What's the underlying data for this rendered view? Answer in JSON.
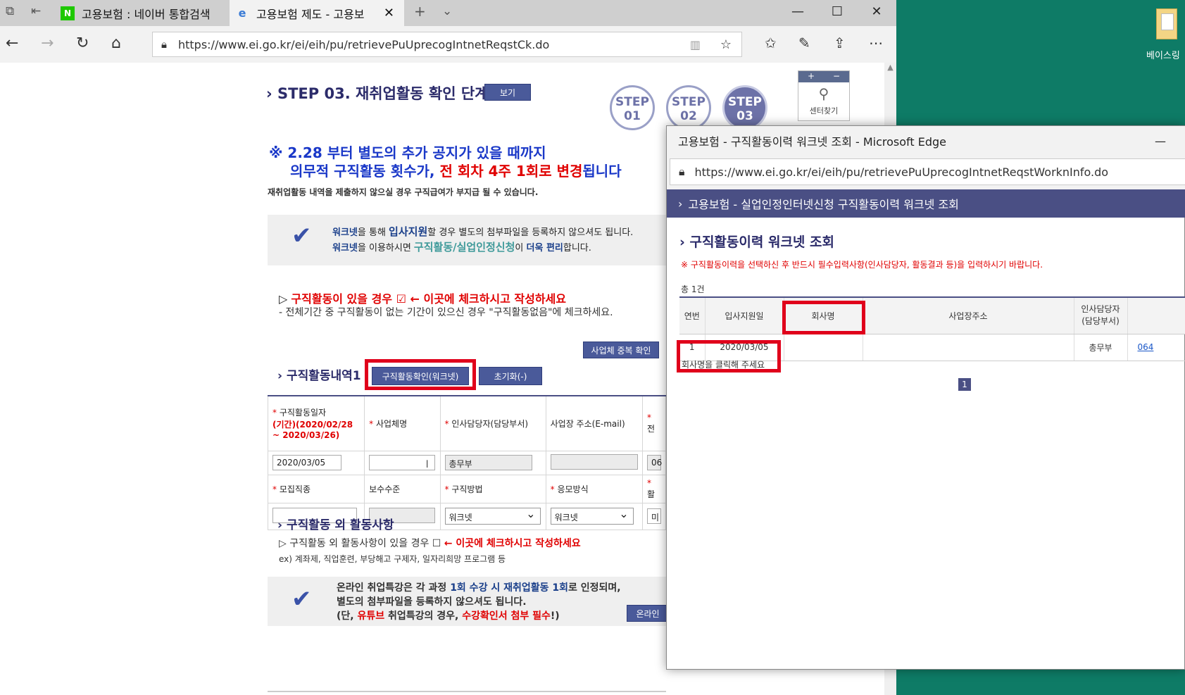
{
  "desktop": {
    "icon_label": "베이스링"
  },
  "browser": {
    "tabs": [
      {
        "label": "고용보험 : 네이버 통합검색",
        "favicon": "N"
      },
      {
        "label": "고용보험 제도 - 고용보",
        "favicon": "e"
      }
    ],
    "url": "https://www.ei.go.kr/ei/eih/pu/retrievePuUprecogIntnetReqstCk.do"
  },
  "page": {
    "step_title": "STEP 03. 재취업활동 확인 단계",
    "view_button": "보기",
    "steps": [
      {
        "top": "STEP",
        "bottom": "01"
      },
      {
        "top": "STEP",
        "bottom": "02"
      },
      {
        "top": "STEP",
        "bottom": "03"
      }
    ],
    "locator": {
      "plus": "+",
      "minus": "−",
      "label": "센터찾기"
    },
    "notice": {
      "line1": "※ 2.28 부터 별도의 추가 공지가 있을 때까지",
      "line2_a": "의무적 구직활동 횟수가, ",
      "line2_b": "전 회차 4주 1회로 변경",
      "line2_c": "됩니다"
    },
    "warning": "재취업활동 내역을 제출하지 않으실 경우 구직급여가 부지급 될 수 있습니다.",
    "info1": {
      "l1_a": "워크넷",
      "l1_b": "을 통해 ",
      "l1_c": "입사지원",
      "l1_d": "할 경우 별도의 첨부파일을 등록하지 않으셔도 됩니다.",
      "l2_a": "워크넷",
      "l2_b": "을 이용하시면 ",
      "l2_c": "구직활동/실업인정신청",
      "l2_d": "이 ",
      "l2_e": "더욱 편리",
      "l2_f": "합니다."
    },
    "job_check": {
      "prefix": "▷ ",
      "red": "구직활동이 있을 경우 ☑ ← 이곳에 체크하시고 작성하세요",
      "sub": "- 전체기간 중 구직활동이 없는 기간이 있으신 경우 \"구직활동없음\"에 체크하세요."
    },
    "dup_button": "사업체 중복 확인",
    "section1": {
      "title": "구직활동내역1",
      "worknet_button": "구직활동확인(워크넷)",
      "reset_button": "초기화(-)"
    },
    "form": {
      "h_date": "구직활동일자",
      "h_period": "(기간)(2020/02/28 ~ 2020/03/26)",
      "h_company": "사업체명",
      "h_hr": "인사담당자(담당부서)",
      "h_addr": "사업장 주소(E-mail)",
      "h_next": "전",
      "v_date": "2020/03/05",
      "v_company": "ㅣ",
      "v_hr": "총무부",
      "v_addr": "",
      "v_next": "06",
      "h_job": "모집직종",
      "h_pay": "보수수준",
      "h_method": "구직방법",
      "h_apply": "응모방식",
      "h_result": "활",
      "v_method": "워크넷",
      "v_apply": "워크넷",
      "v_result": "미"
    },
    "section2": {
      "title": "구직활동 외 활동사항",
      "check_a": "▷ 구직활동 외 활동사항이 있을 경우 ☐ ",
      "check_b": "← 이곳에 체크하시고 작성하세요",
      "example": "ex) 계좌제, 직업훈련, 부당해고 구제자, 일자리희망 프로그램 등"
    },
    "info2": {
      "l1_a": "온라인 취업특강은 각 과정 ",
      "l1_b": "1회 수강 시 재취업활동 1회",
      "l1_c": "로 인정되며,",
      "l2": "별도의 첨부파일을 등록하지 않으셔도 됩니다.",
      "l3_a": "(단, ",
      "l3_b": "유튜브",
      "l3_c": " 취업특강의 경우, ",
      "l3_d": "수강확인서 첨부 필수",
      "l3_e": "!)",
      "button": "온라인"
    }
  },
  "popup": {
    "title": "고용보험 - 구직활동이력 워크넷 조회 - Microsoft Edge",
    "min": "—",
    "url": "https://www.ei.go.kr/ei/eih/pu/retrievePuUprecogIntnetReqstWorknInfo.do",
    "banner": "고용보험 - 실업인정인터넷신청 구직활동이력 워크넷 조회",
    "heading": "구직활동이력 워크넷 조회",
    "notice": "※ 구직활동이력을 선택하신 후 반드시 필수입력사항(인사담당자, 활동결과 등)을 입력하시기 바랍니다.",
    "total": "총 1건",
    "columns": [
      "연번",
      "입사지원일",
      "회사명",
      "사업장주소",
      "인사담당자\n(담당부서)",
      ""
    ],
    "rows": [
      {
        "no": "1",
        "date": "2020/03/05",
        "company": "",
        "addr": "",
        "hr": "총무부",
        "phone": "064"
      }
    ],
    "hint": "회사명을 클릭해 주세요",
    "page": "1"
  },
  "colors": {
    "accent": "#4a4f84",
    "desktop": "#0e7b66",
    "highlight": "#e0001b"
  }
}
